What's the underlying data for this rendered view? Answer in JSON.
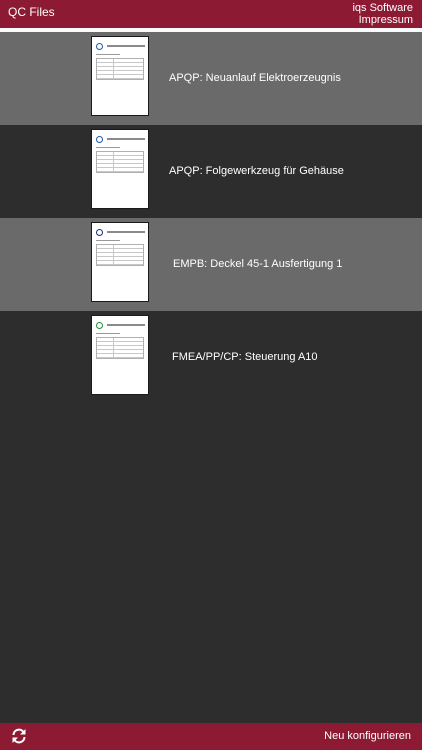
{
  "header": {
    "title": "QC Files",
    "brand_line1": "iqs Software",
    "brand_line2": "Impressum"
  },
  "files": [
    {
      "label": "APQP: Neuanlauf Elektroerzeugnis",
      "icon": "document-thumbnail-icon"
    },
    {
      "label": "APQP: Folgewerkzeug für Gehäuse",
      "icon": "document-thumbnail-icon"
    },
    {
      "label": "EMPB: Deckel 45-1 Ausfertigung 1",
      "icon": "document-thumbnail-icon"
    },
    {
      "label": "FMEA/PP/CP: Steuerung A10",
      "icon": "document-thumbnail-icon"
    }
  ],
  "footer": {
    "refresh_icon": "refresh-icon",
    "action_label": "Neu konfigurieren"
  },
  "colors": {
    "brand": "#8c1a33",
    "row_light": "#6a6a6a",
    "row_dark": "#2d2d2d",
    "text": "#ffffff"
  }
}
